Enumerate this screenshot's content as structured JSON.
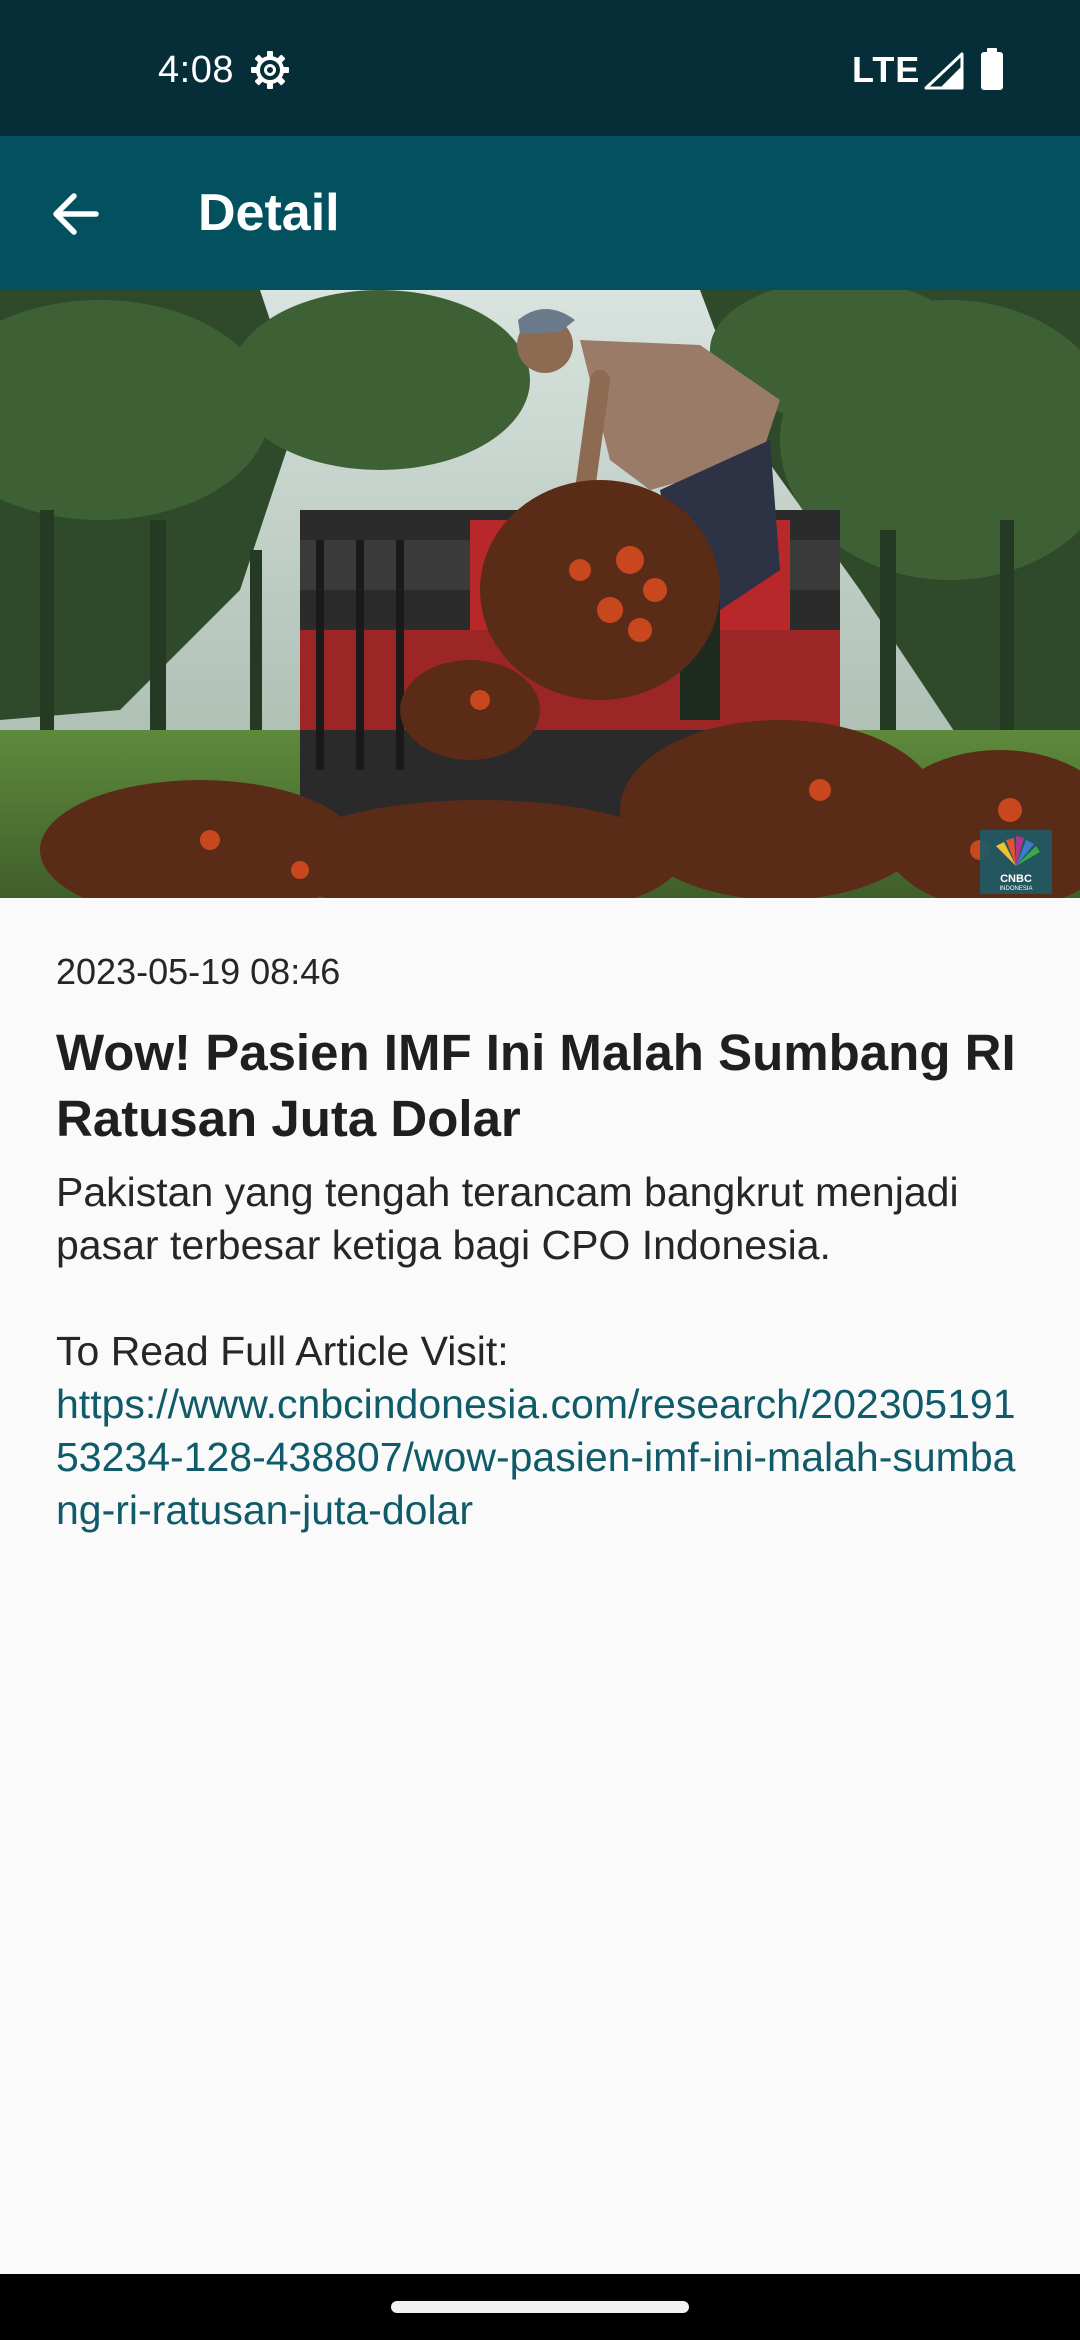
{
  "status_bar": {
    "time": "4:08",
    "network": "LTE",
    "icons": [
      "settings-gear-icon",
      "signal-icon",
      "battery-icon"
    ]
  },
  "app_bar": {
    "title": "Detail",
    "back_icon": "arrow-back-icon"
  },
  "article": {
    "image_logo_text": "CNBC INDONESIA",
    "date": "2023-05-19 08:46",
    "title": "Wow! Pasien IMF Ini Malah Sumbang RI Ratusan Juta Dolar",
    "summary": "Pakistan yang tengah terancam bangkrut menjadi pasar terbesar ketiga bagi CPO Indonesia.",
    "visit_label": "To Read Full Article Visit:",
    "url": "https://www.cnbcindonesia.com/research/20230519153234-128-438807/wow-pasien-imf-ini-malah-sumbang-ri-ratusan-juta-dolar"
  },
  "colors": {
    "status_bar": "#062e39",
    "app_bar": "#03505f",
    "background": "#fafafa",
    "link": "#0f5b69"
  }
}
